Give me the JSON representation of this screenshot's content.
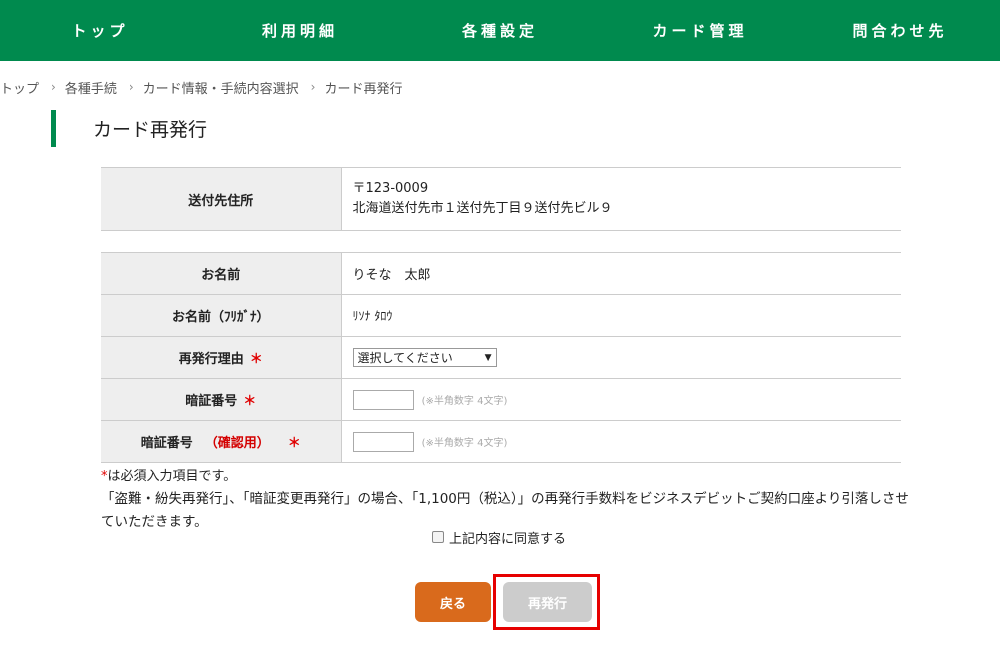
{
  "nav": {
    "items": [
      {
        "label": "トップ"
      },
      {
        "label": "利用明細"
      },
      {
        "label": "各種設定"
      },
      {
        "label": "カード管理"
      },
      {
        "label": "問合わせ先"
      }
    ]
  },
  "breadcrumb": {
    "items": [
      "トップ",
      "各種手続",
      "カード情報・手続内容選択",
      "カード再発行"
    ],
    "separator": "›"
  },
  "page": {
    "title": "カード再発行"
  },
  "address": {
    "label": "送付先住所",
    "postal": "〒123-0009",
    "line": "北海道送付先市１送付先丁目９送付先ビル９"
  },
  "form": {
    "name_label": "お名前",
    "name_value": "りそな　太郎",
    "kana_label": "お名前（ﾌﾘｶﾞﾅ）",
    "kana_value": "ﾘｿﾅ ﾀﾛｳ",
    "reason_label": "再発行理由",
    "reason_selected": "選択してください",
    "pin_label": "暗証番号",
    "pin_confirm_label": "暗証番号",
    "pin_confirm_tag": "（確認用）",
    "pin_hint": "(※半角数字 4文字)",
    "required_mark": "＊",
    "pin_value": "",
    "pin_confirm_value": ""
  },
  "notes": {
    "required_star": "*",
    "required_text": "は必須入力項目です。",
    "fee": "「盗難・紛失再発行」、「暗証変更再発行」の場合、「1,100円（税込）」の再発行手数料をビジネスデビットご契約口座より引落しさせていただきます。",
    "agree": "上記内容に同意する"
  },
  "buttons": {
    "back": "戻る",
    "reissue": "再発行"
  },
  "colors": {
    "brand_green": "#008a4e",
    "back_button": "#d96a1c",
    "disabled_button": "#cccccc",
    "required_red": "#e00000",
    "highlight": "#e60000"
  }
}
